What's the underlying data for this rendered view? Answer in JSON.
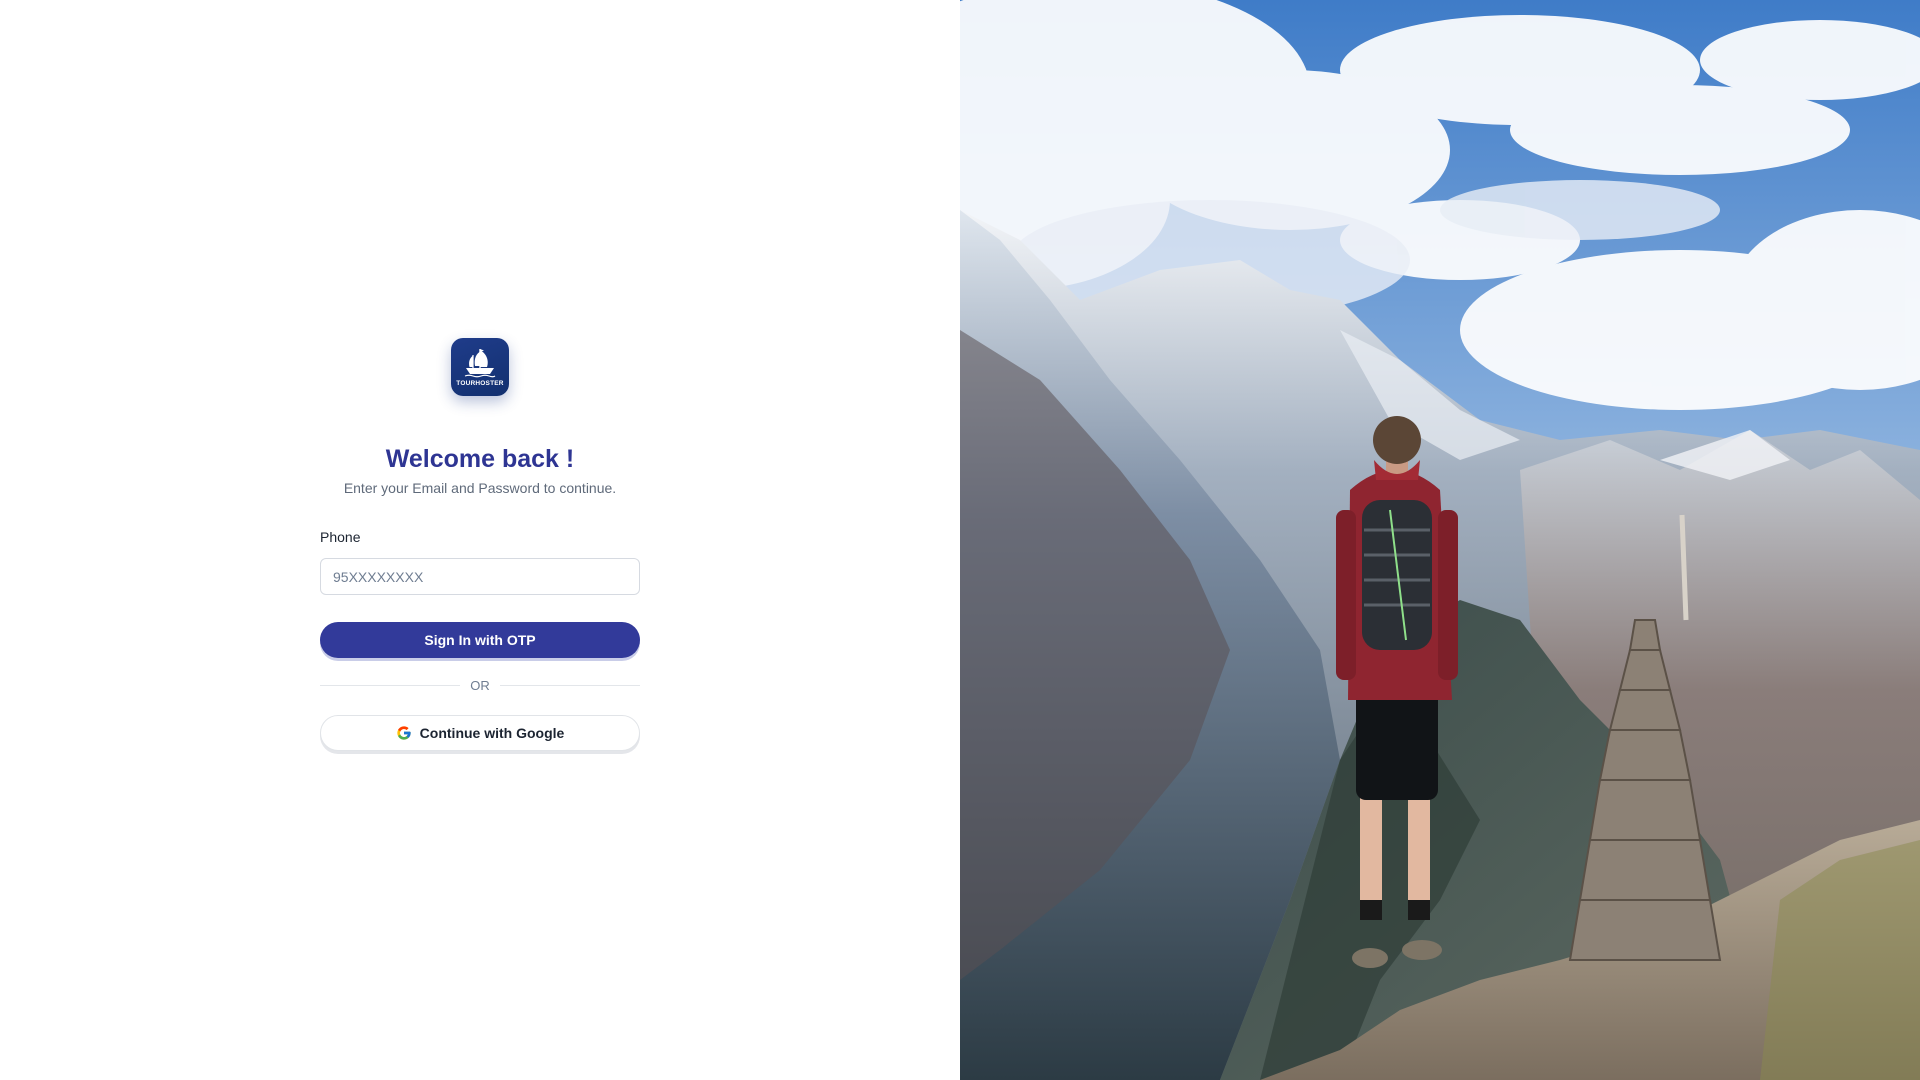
{
  "brand": {
    "logo_text": "TOURHOSTER",
    "icon": "ship-logo-icon",
    "color": "#1f3c8a"
  },
  "login": {
    "title": "Welcome back !",
    "subtitle": "Enter your Email and Password to continue.",
    "phone_label": "Phone",
    "phone_placeholder": "95XXXXXXXX",
    "phone_value": "",
    "otp_button_label": "Sign In with OTP",
    "divider_text": "OR",
    "google_button_label": "Continue with Google",
    "google_icon": "google-icon",
    "accent_color": "#323a9a",
    "title_color": "#2e3593"
  },
  "hero": {
    "image": "hiker-on-mountain-cliff-photo"
  }
}
